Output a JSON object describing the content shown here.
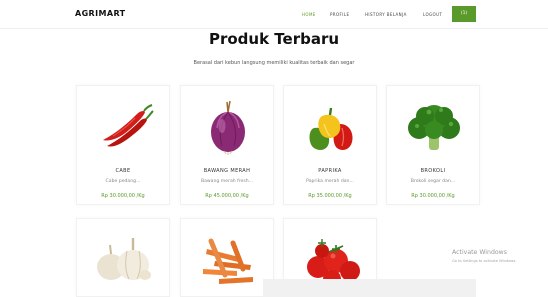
{
  "navbar": {
    "brand": "AGRIMART",
    "links": [
      "HOME",
      "PROFILE",
      "HISTORY BELANJA",
      "LOGOUT"
    ],
    "cart_label": "(1)"
  },
  "main": {
    "title": "Produk Terbaru",
    "subtitle": "Berasal dari kebun langsung memiliki kualitas terbaik dan segar"
  },
  "products": [
    {
      "name": "CABE",
      "desc": "Cabe pedang...",
      "price": "Rp 30.000,00 /Kg",
      "icon": "chili-icon"
    },
    {
      "name": "BAWANG MERAH",
      "desc": "Bawang merah fresh...",
      "price": "Rp 45.000,00 /Kg",
      "icon": "red-onion-icon"
    },
    {
      "name": "PAPRIKA",
      "desc": "Paprika merah dan...",
      "price": "Rp 35.000,00 /Kg",
      "icon": "bell-pepper-icon"
    },
    {
      "name": "BROKOLI",
      "desc": "Brokoli segar dan...",
      "price": "Rp 30.000,00 /Kg",
      "icon": "broccoli-icon"
    },
    {
      "icon": "garlic-icon"
    },
    {
      "icon": "carrot-icon"
    },
    {
      "icon": "tomato-icon"
    }
  ],
  "watermark": {
    "title": "Activate Windows",
    "subtitle": "Go to Settings to activate Windows."
  }
}
